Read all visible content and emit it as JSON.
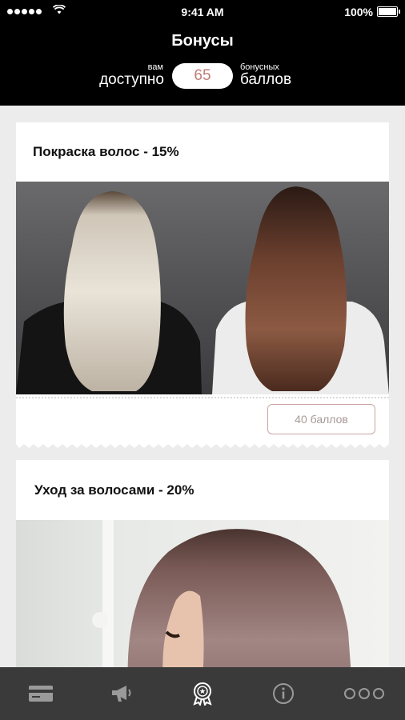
{
  "status_bar": {
    "time": "9:41 AM",
    "battery": "100%"
  },
  "header": {
    "title": "Бонусы",
    "available_small": "вам",
    "available_big": "доступно",
    "points": "65",
    "points_small": "бонусных",
    "points_big": "баллов"
  },
  "cards": [
    {
      "title": "Покраска волос - 15%",
      "cost": "40 баллов",
      "image": "hair-coloring-photo"
    },
    {
      "title": "Уход за волосами - 20%",
      "image": "hair-care-photo"
    }
  ],
  "tab_bar": {
    "items": [
      {
        "icon": "card-icon",
        "active": false
      },
      {
        "icon": "megaphone-icon",
        "active": false
      },
      {
        "icon": "award-badge-icon",
        "active": true
      },
      {
        "icon": "info-icon",
        "active": false
      },
      {
        "icon": "more-dots-icon",
        "active": false
      }
    ]
  },
  "colors": {
    "header_bg": "#000000",
    "page_bg": "#ececec",
    "accent": "#c07c79",
    "tab_bar_bg": "#3a3a3a",
    "tab_active": "#ffffff",
    "tab_inactive": "#9a9a9a"
  }
}
